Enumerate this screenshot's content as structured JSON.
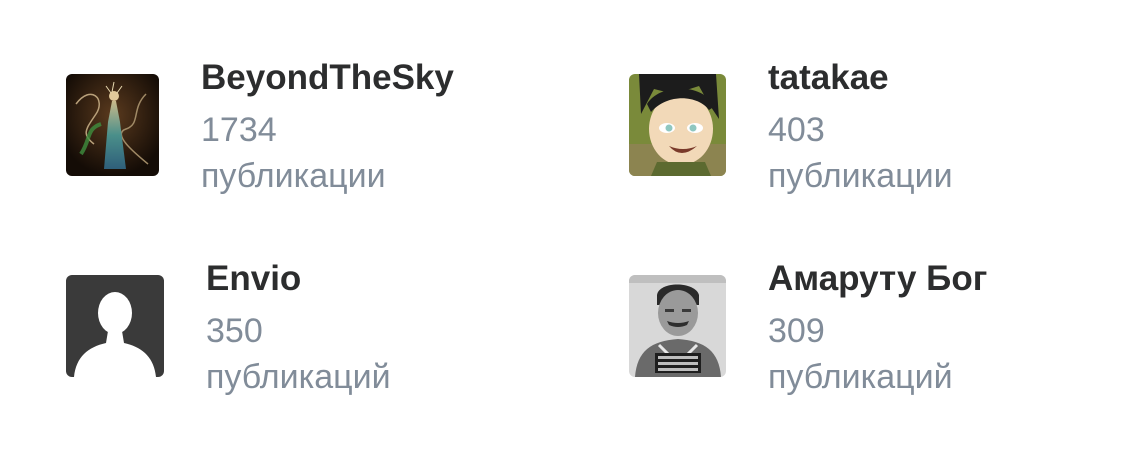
{
  "users": [
    {
      "name": "BeyondTheSky",
      "count": "1734",
      "unit": "публикации",
      "avatar_icon": "fantasy-figure-avatar"
    },
    {
      "name": "tatakae",
      "count": "403",
      "unit": "публикации",
      "avatar_icon": "anime-girl-avatar"
    },
    {
      "name": "Envio",
      "count": "350",
      "unit": "публикаций",
      "avatar_icon": "default-silhouette-avatar"
    },
    {
      "name": "Амаруту Бог",
      "count": "309",
      "unit": "публикаций",
      "avatar_icon": "mugshot-photo-avatar"
    }
  ],
  "colors": {
    "name_text": "#2c2d2e",
    "secondary_text": "#818c99",
    "background": "#ffffff"
  }
}
